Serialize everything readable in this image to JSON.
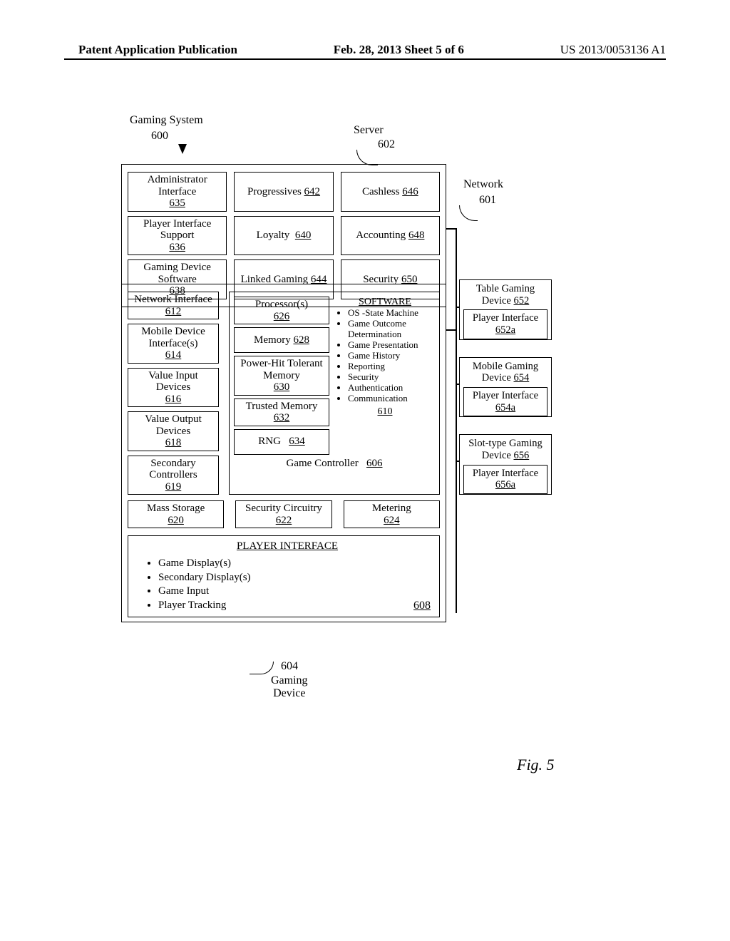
{
  "header": {
    "left": "Patent Application Publication",
    "center": "Feb. 28, 2013  Sheet 5 of 6",
    "right": "US 2013/0053136 A1"
  },
  "labels": {
    "gaming_system": "Gaming System",
    "gaming_system_num": "600",
    "server": "Server",
    "server_num": "602",
    "network": "Network",
    "network_num": "601",
    "gaming_device": "Gaming\nDevice",
    "gaming_device_num": "604",
    "figure": "Fig. 5"
  },
  "server_modules": [
    {
      "name": "Administrator Interface",
      "num": "635"
    },
    {
      "name": "Progressives",
      "num": "642"
    },
    {
      "name": "Cashless",
      "num": "646"
    },
    {
      "name": "Player Interface Support",
      "num": "636"
    },
    {
      "name": "Loyalty",
      "num": "640"
    },
    {
      "name": "Accounting",
      "num": "648"
    },
    {
      "name": "Gaming Device Software",
      "num": "638"
    },
    {
      "name": "Linked Gaming",
      "num": "644"
    },
    {
      "name": "Security",
      "num": "650"
    }
  ],
  "device_left": [
    {
      "name": "Network Interface",
      "num": "612"
    },
    {
      "name": "Mobile Device Interface(s)",
      "num": "614"
    },
    {
      "name": "Value Input Devices",
      "num": "616"
    },
    {
      "name": "Value Output Devices",
      "num": "618"
    },
    {
      "name": "Secondary Controllers",
      "num": "619"
    }
  ],
  "controller": {
    "caption": "Game Controller",
    "caption_num": "606",
    "left": [
      {
        "name": "Processor(s)",
        "num": "626"
      },
      {
        "name": "Memory",
        "num": "628"
      },
      {
        "name": "Power-Hit Tolerant Memory",
        "num": "630"
      },
      {
        "name": "Trusted Memory",
        "num": "632"
      },
      {
        "name": "RNG",
        "num": "634"
      }
    ],
    "software": {
      "title": "SOFTWARE",
      "num": "610",
      "items": [
        "OS -State Machine",
        "Game Outcome Determination",
        "Game Presentation",
        "Game History",
        "Reporting",
        "Security",
        "Authentication",
        "Communication"
      ]
    }
  },
  "device_row3": [
    {
      "name": "Mass Storage",
      "num": "620"
    },
    {
      "name": "Security Circuitry",
      "num": "622"
    },
    {
      "name": "Metering",
      "num": "624"
    }
  ],
  "player_interface": {
    "title": "PLAYER INTERFACE",
    "num": "608",
    "items": [
      "Game Display(s)",
      "Secondary Display(s)",
      "Game Input",
      "Player Tracking"
    ]
  },
  "network_devices": [
    {
      "name": "Table Gaming Device",
      "num": "652",
      "sub": "Player Interface",
      "sub_num": "652a"
    },
    {
      "name": "Mobile Gaming Device",
      "num": "654",
      "sub": "Player Interface",
      "sub_num": "654a"
    },
    {
      "name": "Slot-type Gaming Device",
      "num": "656",
      "sub": "Player Interface",
      "sub_num": "656a"
    }
  ]
}
